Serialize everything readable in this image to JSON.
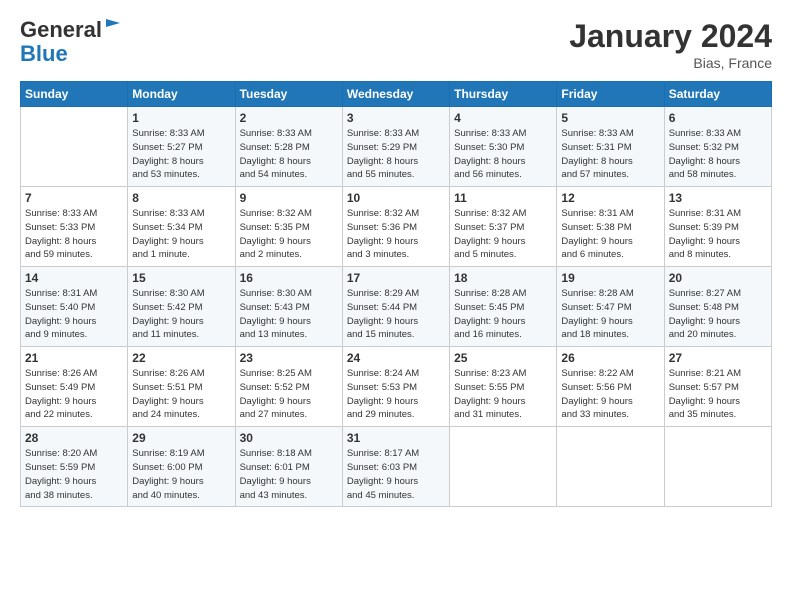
{
  "logo": {
    "line1": "General",
    "line2": "Blue"
  },
  "title": "January 2024",
  "location": "Bias, France",
  "days_header": [
    "Sunday",
    "Monday",
    "Tuesday",
    "Wednesday",
    "Thursday",
    "Friday",
    "Saturday"
  ],
  "weeks": [
    [
      {
        "day": "",
        "info": ""
      },
      {
        "day": "1",
        "info": "Sunrise: 8:33 AM\nSunset: 5:27 PM\nDaylight: 8 hours\nand 53 minutes."
      },
      {
        "day": "2",
        "info": "Sunrise: 8:33 AM\nSunset: 5:28 PM\nDaylight: 8 hours\nand 54 minutes."
      },
      {
        "day": "3",
        "info": "Sunrise: 8:33 AM\nSunset: 5:29 PM\nDaylight: 8 hours\nand 55 minutes."
      },
      {
        "day": "4",
        "info": "Sunrise: 8:33 AM\nSunset: 5:30 PM\nDaylight: 8 hours\nand 56 minutes."
      },
      {
        "day": "5",
        "info": "Sunrise: 8:33 AM\nSunset: 5:31 PM\nDaylight: 8 hours\nand 57 minutes."
      },
      {
        "day": "6",
        "info": "Sunrise: 8:33 AM\nSunset: 5:32 PM\nDaylight: 8 hours\nand 58 minutes."
      }
    ],
    [
      {
        "day": "7",
        "info": "Sunrise: 8:33 AM\nSunset: 5:33 PM\nDaylight: 8 hours\nand 59 minutes."
      },
      {
        "day": "8",
        "info": "Sunrise: 8:33 AM\nSunset: 5:34 PM\nDaylight: 9 hours\nand 1 minute."
      },
      {
        "day": "9",
        "info": "Sunrise: 8:32 AM\nSunset: 5:35 PM\nDaylight: 9 hours\nand 2 minutes."
      },
      {
        "day": "10",
        "info": "Sunrise: 8:32 AM\nSunset: 5:36 PM\nDaylight: 9 hours\nand 3 minutes."
      },
      {
        "day": "11",
        "info": "Sunrise: 8:32 AM\nSunset: 5:37 PM\nDaylight: 9 hours\nand 5 minutes."
      },
      {
        "day": "12",
        "info": "Sunrise: 8:31 AM\nSunset: 5:38 PM\nDaylight: 9 hours\nand 6 minutes."
      },
      {
        "day": "13",
        "info": "Sunrise: 8:31 AM\nSunset: 5:39 PM\nDaylight: 9 hours\nand 8 minutes."
      }
    ],
    [
      {
        "day": "14",
        "info": "Sunrise: 8:31 AM\nSunset: 5:40 PM\nDaylight: 9 hours\nand 9 minutes."
      },
      {
        "day": "15",
        "info": "Sunrise: 8:30 AM\nSunset: 5:42 PM\nDaylight: 9 hours\nand 11 minutes."
      },
      {
        "day": "16",
        "info": "Sunrise: 8:30 AM\nSunset: 5:43 PM\nDaylight: 9 hours\nand 13 minutes."
      },
      {
        "day": "17",
        "info": "Sunrise: 8:29 AM\nSunset: 5:44 PM\nDaylight: 9 hours\nand 15 minutes."
      },
      {
        "day": "18",
        "info": "Sunrise: 8:28 AM\nSunset: 5:45 PM\nDaylight: 9 hours\nand 16 minutes."
      },
      {
        "day": "19",
        "info": "Sunrise: 8:28 AM\nSunset: 5:47 PM\nDaylight: 9 hours\nand 18 minutes."
      },
      {
        "day": "20",
        "info": "Sunrise: 8:27 AM\nSunset: 5:48 PM\nDaylight: 9 hours\nand 20 minutes."
      }
    ],
    [
      {
        "day": "21",
        "info": "Sunrise: 8:26 AM\nSunset: 5:49 PM\nDaylight: 9 hours\nand 22 minutes."
      },
      {
        "day": "22",
        "info": "Sunrise: 8:26 AM\nSunset: 5:51 PM\nDaylight: 9 hours\nand 24 minutes."
      },
      {
        "day": "23",
        "info": "Sunrise: 8:25 AM\nSunset: 5:52 PM\nDaylight: 9 hours\nand 27 minutes."
      },
      {
        "day": "24",
        "info": "Sunrise: 8:24 AM\nSunset: 5:53 PM\nDaylight: 9 hours\nand 29 minutes."
      },
      {
        "day": "25",
        "info": "Sunrise: 8:23 AM\nSunset: 5:55 PM\nDaylight: 9 hours\nand 31 minutes."
      },
      {
        "day": "26",
        "info": "Sunrise: 8:22 AM\nSunset: 5:56 PM\nDaylight: 9 hours\nand 33 minutes."
      },
      {
        "day": "27",
        "info": "Sunrise: 8:21 AM\nSunset: 5:57 PM\nDaylight: 9 hours\nand 35 minutes."
      }
    ],
    [
      {
        "day": "28",
        "info": "Sunrise: 8:20 AM\nSunset: 5:59 PM\nDaylight: 9 hours\nand 38 minutes."
      },
      {
        "day": "29",
        "info": "Sunrise: 8:19 AM\nSunset: 6:00 PM\nDaylight: 9 hours\nand 40 minutes."
      },
      {
        "day": "30",
        "info": "Sunrise: 8:18 AM\nSunset: 6:01 PM\nDaylight: 9 hours\nand 43 minutes."
      },
      {
        "day": "31",
        "info": "Sunrise: 8:17 AM\nSunset: 6:03 PM\nDaylight: 9 hours\nand 45 minutes."
      },
      {
        "day": "",
        "info": ""
      },
      {
        "day": "",
        "info": ""
      },
      {
        "day": "",
        "info": ""
      }
    ]
  ]
}
